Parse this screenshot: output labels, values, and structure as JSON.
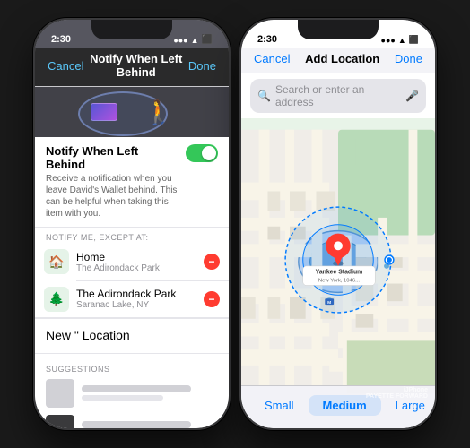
{
  "phones": {
    "left": {
      "status": {
        "time": "2:30",
        "icons": "● ▲ ⬛"
      },
      "nav": {
        "cancel": "Cancel",
        "title": "Notify When Left Behind",
        "done": "Done"
      },
      "notify": {
        "title": "Notify When Left Behind",
        "description": "Receive a notification when you leave David's Wallet behind. This can be helpful when taking this item with you.",
        "toggle": "on"
      },
      "section_label": "NOTIFY ME, EXCEPT AT:",
      "locations": [
        {
          "name": "Home",
          "sub": "The Adirondack Park",
          "emoji": "🏠"
        },
        {
          "name": "The Adirondack Park",
          "sub": "Saranac Lake, NY",
          "emoji": "🌲"
        }
      ],
      "new_location": "New \" Location",
      "suggestions_label": "SUGGESTIONS"
    },
    "right": {
      "status": {
        "time": "2:30"
      },
      "nav": {
        "cancel": "Cancel",
        "title": "Add Location",
        "done": "Done"
      },
      "search": {
        "placeholder": "Search or enter an address"
      },
      "map": {
        "label": "Yankee Stadium",
        "sub": "New York, 1046..."
      },
      "sizes": [
        "Small",
        "Medium",
        "Large"
      ],
      "active_size": "Medium"
    }
  },
  "watermark": {
    "line1": "iJPhone",
    "line2": "PAYETTE FORWARD"
  }
}
